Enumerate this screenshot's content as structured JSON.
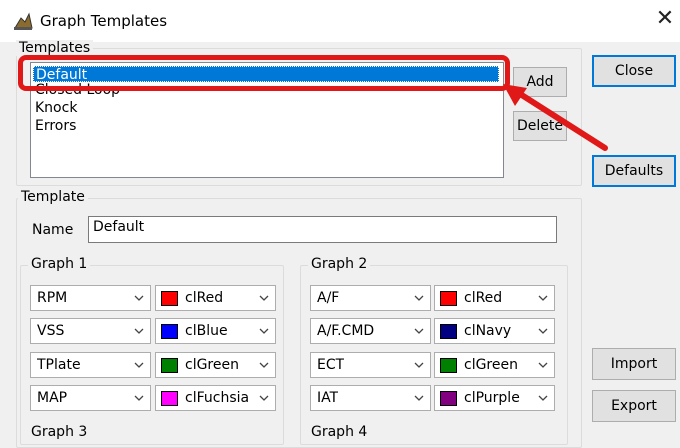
{
  "window": {
    "title": "Graph Templates"
  },
  "templates_group": {
    "label": "Templates",
    "items": [
      "Default",
      "Closed Loop",
      "Knock",
      "Errors"
    ],
    "selected_index": 0,
    "add_label": "Add",
    "delete_label": "Delete"
  },
  "side_buttons": {
    "close": "Close",
    "defaults": "Defaults",
    "import": "Import",
    "export": "Export"
  },
  "template_group": {
    "label": "Template",
    "name_label": "Name",
    "name_value": "Default"
  },
  "graphs": [
    {
      "label": "Graph 1",
      "rows": [
        {
          "channel": "RPM",
          "color_name": "clRed",
          "swatch": "#ff0000"
        },
        {
          "channel": "VSS",
          "color_name": "clBlue",
          "swatch": "#0000ff"
        },
        {
          "channel": "TPlate",
          "color_name": "clGreen",
          "swatch": "#008000"
        },
        {
          "channel": "MAP",
          "color_name": "clFuchsia",
          "swatch": "#ff00ff"
        }
      ]
    },
    {
      "label": "Graph 2",
      "rows": [
        {
          "channel": "A/F",
          "color_name": "clRed",
          "swatch": "#ff0000"
        },
        {
          "channel": "A/F.CMD",
          "color_name": "clNavy",
          "swatch": "#000080"
        },
        {
          "channel": "ECT",
          "color_name": "clGreen",
          "swatch": "#008000"
        },
        {
          "channel": "IAT",
          "color_name": "clPurple",
          "swatch": "#800080"
        }
      ]
    },
    {
      "label": "Graph 3",
      "rows": []
    },
    {
      "label": "Graph 4",
      "rows": []
    }
  ],
  "colors": {
    "highlight": "#e01818",
    "selection": "#0078d7"
  }
}
